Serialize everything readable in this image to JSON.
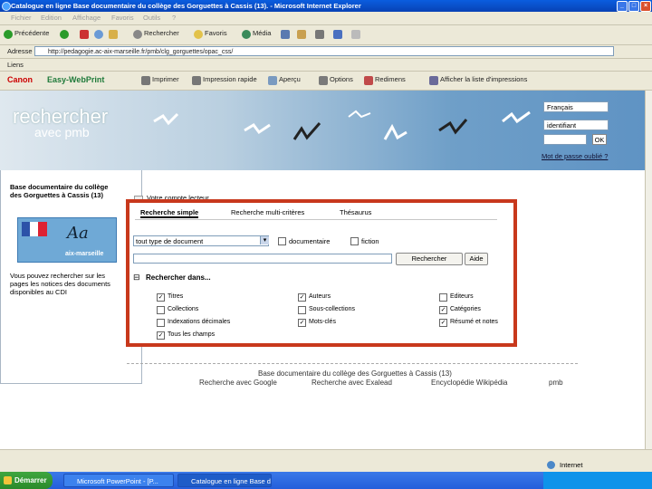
{
  "window": {
    "title": "Catalogue en ligne Base documentaire du collège des Gorguettes à Cassis (13). - Microsoft Internet Explorer",
    "buttons": [
      "_",
      "□",
      "×"
    ]
  },
  "menu": [
    "Fichier",
    "Edition",
    "Affichage",
    "Favoris",
    "Outils",
    "?"
  ],
  "toolbar": {
    "back": "Précédente",
    "search": "Rechercher",
    "favorites": "Favoris",
    "media": "Média"
  },
  "address": {
    "label": "Adresse",
    "url": "http://pedagogie.ac-aix-marseille.fr/pmb/clg_gorguettes/opac_css/"
  },
  "links_label": "Liens",
  "canon_bar": {
    "brand": "Canon",
    "product": "Easy-WebPrint",
    "items": [
      "Imprimer",
      "Impression rapide",
      "Aperçu",
      "Options",
      "Redimens",
      "Afficher la liste d'impressions"
    ]
  },
  "banner": {
    "title": "rechercher",
    "subtitle": "avec pmb",
    "language": "Français",
    "login_placeholder": "identifiant",
    "ok": "OK",
    "forgot": "Mot de passe oublié ?"
  },
  "sidebar": {
    "title": "Base documentaire du collège des Gorguettes à Cassis (13)",
    "logo_text": "aix-marseille",
    "description": "Vous pouvez rechercher sur les pages les notices des documents disponibles au CDI"
  },
  "nav_link": "Votre compte lecteur",
  "search": {
    "tabs": [
      "Recherche simple",
      "Recherche multi-critères",
      "Thésaurus"
    ],
    "doc_type": "tout type de document",
    "cb_documentaire": "documentaire",
    "cb_fiction": "fiction",
    "search_button": "Rechercher",
    "help_button": "Aide",
    "search_in": "Rechercher dans...",
    "fields": [
      {
        "label": "Titres",
        "checked": true
      },
      {
        "label": "Auteurs",
        "checked": true
      },
      {
        "label": "Editeurs",
        "checked": false
      },
      {
        "label": "Collections",
        "checked": false
      },
      {
        "label": "Sous-collections",
        "checked": false
      },
      {
        "label": "Catégories",
        "checked": true
      },
      {
        "label": "Indexations décimales",
        "checked": false
      },
      {
        "label": "Mots-clés",
        "checked": true
      },
      {
        "label": "Résumé et notes",
        "checked": true
      },
      {
        "label": "Tous les champs",
        "checked": true
      }
    ]
  },
  "footer": {
    "title": "Base documentaire du collège des Gorguettes à Cassis (13)",
    "links": [
      "Recherche avec Google",
      "Recherche avec Exalead",
      "Encyclopédie Wikipédia",
      "pmb"
    ]
  },
  "status": {
    "zone": "Internet"
  },
  "taskbar": {
    "start": "Démarrer",
    "tasks": [
      "Microsoft PowerPoint - [P...",
      "Catalogue en ligne Base d..."
    ]
  },
  "colors": {
    "highlight_border": "#c8381c",
    "title_bar": "#0a5ddf",
    "taskbar": "#245edb"
  }
}
